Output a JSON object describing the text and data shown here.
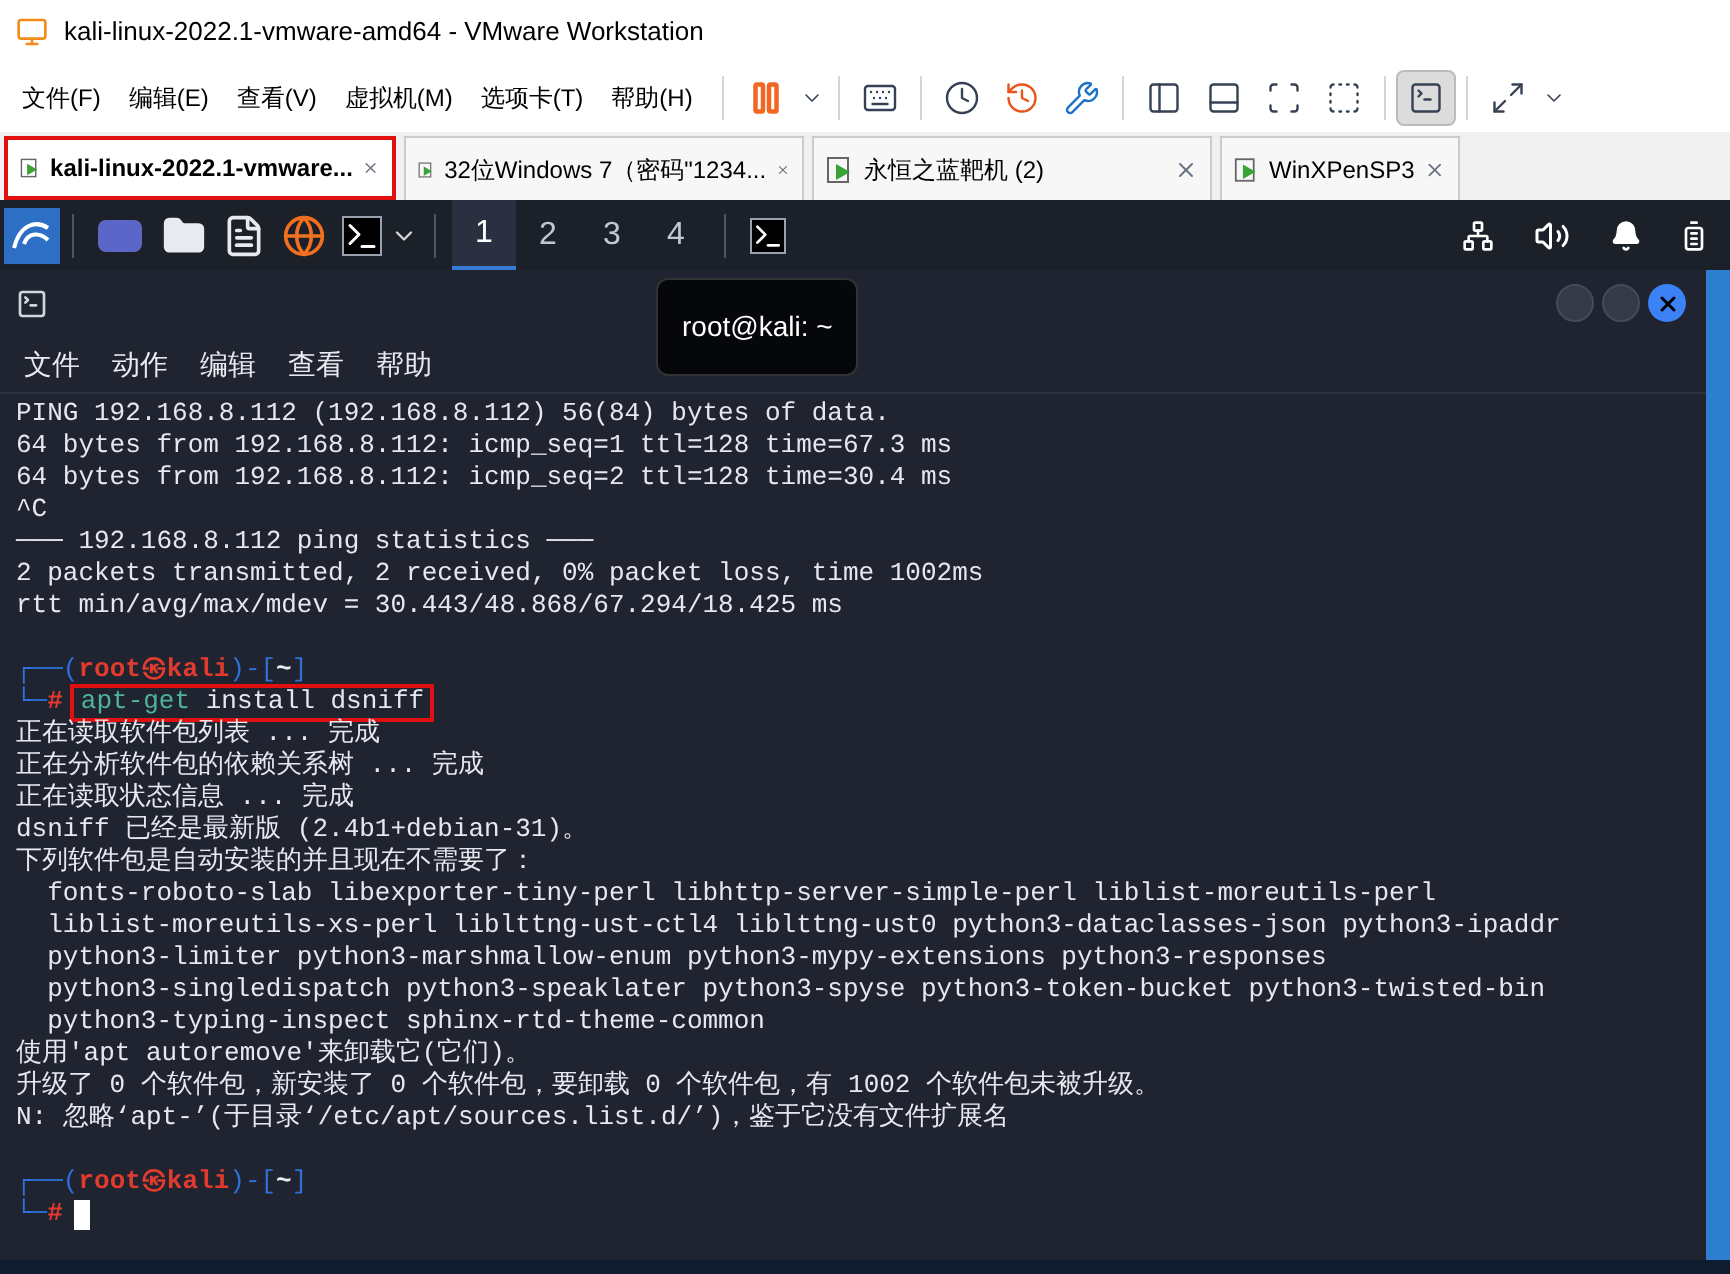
{
  "window": {
    "title": "kali-linux-2022.1-vmware-amd64 - VMware Workstation"
  },
  "menu": [
    "文件(F)",
    "编辑(E)",
    "查看(V)",
    "虚拟机(M)",
    "选项卡(T)",
    "帮助(H)"
  ],
  "toolbar": [
    {
      "kind": "pause"
    },
    {
      "kind": "caret"
    },
    {
      "kind": "sep"
    },
    {
      "kind": "send-keys"
    },
    {
      "kind": "sep"
    },
    {
      "kind": "snapshot"
    },
    {
      "kind": "revert"
    },
    {
      "kind": "manage"
    },
    {
      "kind": "sep"
    },
    {
      "kind": "sidebar"
    },
    {
      "kind": "panel"
    },
    {
      "kind": "fullscreen"
    },
    {
      "kind": "unity"
    },
    {
      "kind": "sep"
    },
    {
      "kind": "console",
      "selected": true
    },
    {
      "kind": "sep"
    },
    {
      "kind": "stretch"
    },
    {
      "kind": "caret"
    }
  ],
  "tabs": [
    {
      "label": "kali-linux-2022.1-vmware...",
      "selected": true,
      "highlighted": true
    },
    {
      "label": "32位Windows 7（密码\"1234...",
      "selected": false,
      "highlighted": false
    },
    {
      "label": "永恒之蓝靶机 (2)",
      "selected": false,
      "highlighted": false
    },
    {
      "label": "WinXPenSP3",
      "selected": false,
      "highlighted": false
    }
  ],
  "panel": {
    "workspaces": [
      {
        "label": "1",
        "selected": true
      },
      {
        "label": "2",
        "selected": false
      },
      {
        "label": "3",
        "selected": false
      },
      {
        "label": "4",
        "selected": false
      }
    ]
  },
  "terminal": {
    "tooltip": "root@kali: ~",
    "menu": [
      "文件",
      "动作",
      "编辑",
      "查看",
      "帮助"
    ],
    "lines": [
      {
        "kind": "text",
        "text": "PING 192.168.8.112 (192.168.8.112) 56(84) bytes of data."
      },
      {
        "kind": "text",
        "text": "64 bytes from 192.168.8.112: icmp_seq=1 ttl=128 time=67.3 ms"
      },
      {
        "kind": "text",
        "text": "64 bytes from 192.168.8.112: icmp_seq=2 ttl=128 time=30.4 ms"
      },
      {
        "kind": "text",
        "text": "^C"
      },
      {
        "kind": "text",
        "text": "─── 192.168.8.112 ping statistics ───"
      },
      {
        "kind": "text",
        "text": "2 packets transmitted, 2 received, 0% packet loss, time 1002ms"
      },
      {
        "kind": "text",
        "text": "rtt min/avg/max/mdev = 30.443/48.868/67.294/18.425 ms"
      },
      {
        "kind": "blank"
      },
      {
        "kind": "prompt",
        "open": "┌──(",
        "user": "root㉿kali",
        "mid": ")-[",
        "dir": "~",
        "close": "]"
      },
      {
        "kind": "command",
        "corner": "└─",
        "hash": "#",
        "program": "apt-get",
        "args": "install dsniff",
        "highlighted": true
      },
      {
        "kind": "text",
        "text": "正在读取软件包列表 ... 完成"
      },
      {
        "kind": "text",
        "text": "正在分析软件包的依赖关系树 ... 完成"
      },
      {
        "kind": "text",
        "text": "正在读取状态信息 ... 完成"
      },
      {
        "kind": "text",
        "text": "dsniff 已经是最新版 (2.4b1+debian-31)。"
      },
      {
        "kind": "text",
        "text": "下列软件包是自动安装的并且现在不需要了："
      },
      {
        "kind": "text",
        "text": "  fonts-roboto-slab libexporter-tiny-perl libhttp-server-simple-perl liblist-moreutils-perl"
      },
      {
        "kind": "text",
        "text": "  liblist-moreutils-xs-perl liblttng-ust-ctl4 liblttng-ust0 python3-dataclasses-json python3-ipaddr"
      },
      {
        "kind": "text",
        "text": "  python3-limiter python3-marshmallow-enum python3-mypy-extensions python3-responses"
      },
      {
        "kind": "text",
        "text": "  python3-singledispatch python3-speaklater python3-spyse python3-token-bucket python3-twisted-bin"
      },
      {
        "kind": "text",
        "text": "  python3-typing-inspect sphinx-rtd-theme-common"
      },
      {
        "kind": "text",
        "text": "使用'apt autoremove'来卸载它(它们)。"
      },
      {
        "kind": "text",
        "text": "升级了 0 个软件包，新安装了 0 个软件包，要卸载 0 个软件包，有 1002 个软件包未被升级。"
      },
      {
        "kind": "text",
        "text": "N: 忽略‘apt-’(于目录‘/etc/apt/sources.list.d/’)，鉴于它没有文件扩展名"
      },
      {
        "kind": "blank"
      },
      {
        "kind": "prompt",
        "open": "┌──(",
        "user": "root㉿kali",
        "mid": ")-[",
        "dir": "~",
        "close": "]"
      },
      {
        "kind": "input",
        "corner": "└─",
        "hash": "#"
      }
    ]
  }
}
